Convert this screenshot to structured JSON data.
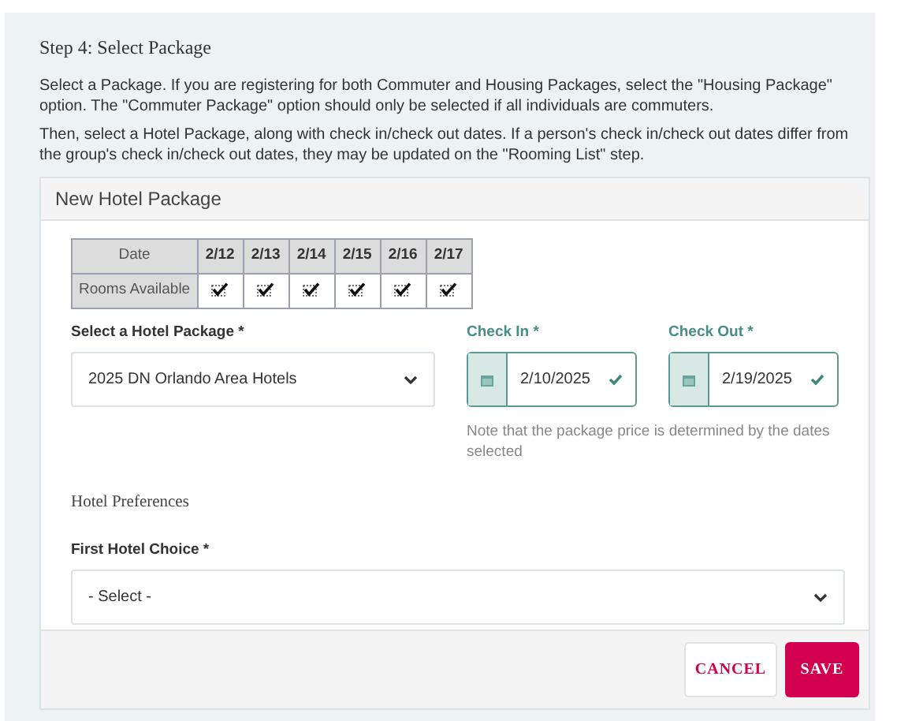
{
  "step_title": "Step 4: Select Package",
  "paragraphs": [
    "Select a Package. If you are registering for both Commuter and Housing Packages, select the \"Housing Package\" option. The \"Commuter Package\" option should only be selected if all individuals are commuters.",
    "Then, select a Hotel Package, along with check in/check out dates. If a person's check in/check out dates differ from the group's check in/check out dates, they may be updated on the \"Rooming List\" step."
  ],
  "card": {
    "title": "New Hotel Package",
    "availability": {
      "date_header": "Date",
      "row_header": "Rooms Available",
      "dates": [
        {
          "label": "2/12",
          "available": true
        },
        {
          "label": "2/13",
          "available": true
        },
        {
          "label": "2/14",
          "available": true
        },
        {
          "label": "2/15",
          "available": true
        },
        {
          "label": "2/16",
          "available": true
        },
        {
          "label": "2/17",
          "available": true
        }
      ]
    },
    "package": {
      "label": "Select a Hotel Package *",
      "value": "2025 DN Orlando Area Hotels"
    },
    "check_in": {
      "label": "Check In *",
      "value": "2/10/2025",
      "valid": true
    },
    "check_out": {
      "label": "Check Out *",
      "value": "2/19/2025",
      "valid": true
    },
    "note": "Note that the package price is determined by the dates selected",
    "preferences_title": "Hotel Preferences",
    "first_choice": {
      "label": "First Hotel Choice *",
      "value": "- Select -"
    },
    "buttons": [
      {
        "label": "CANCEL",
        "kind": "secondary"
      },
      {
        "label": "SAVE",
        "kind": "primary"
      }
    ]
  }
}
